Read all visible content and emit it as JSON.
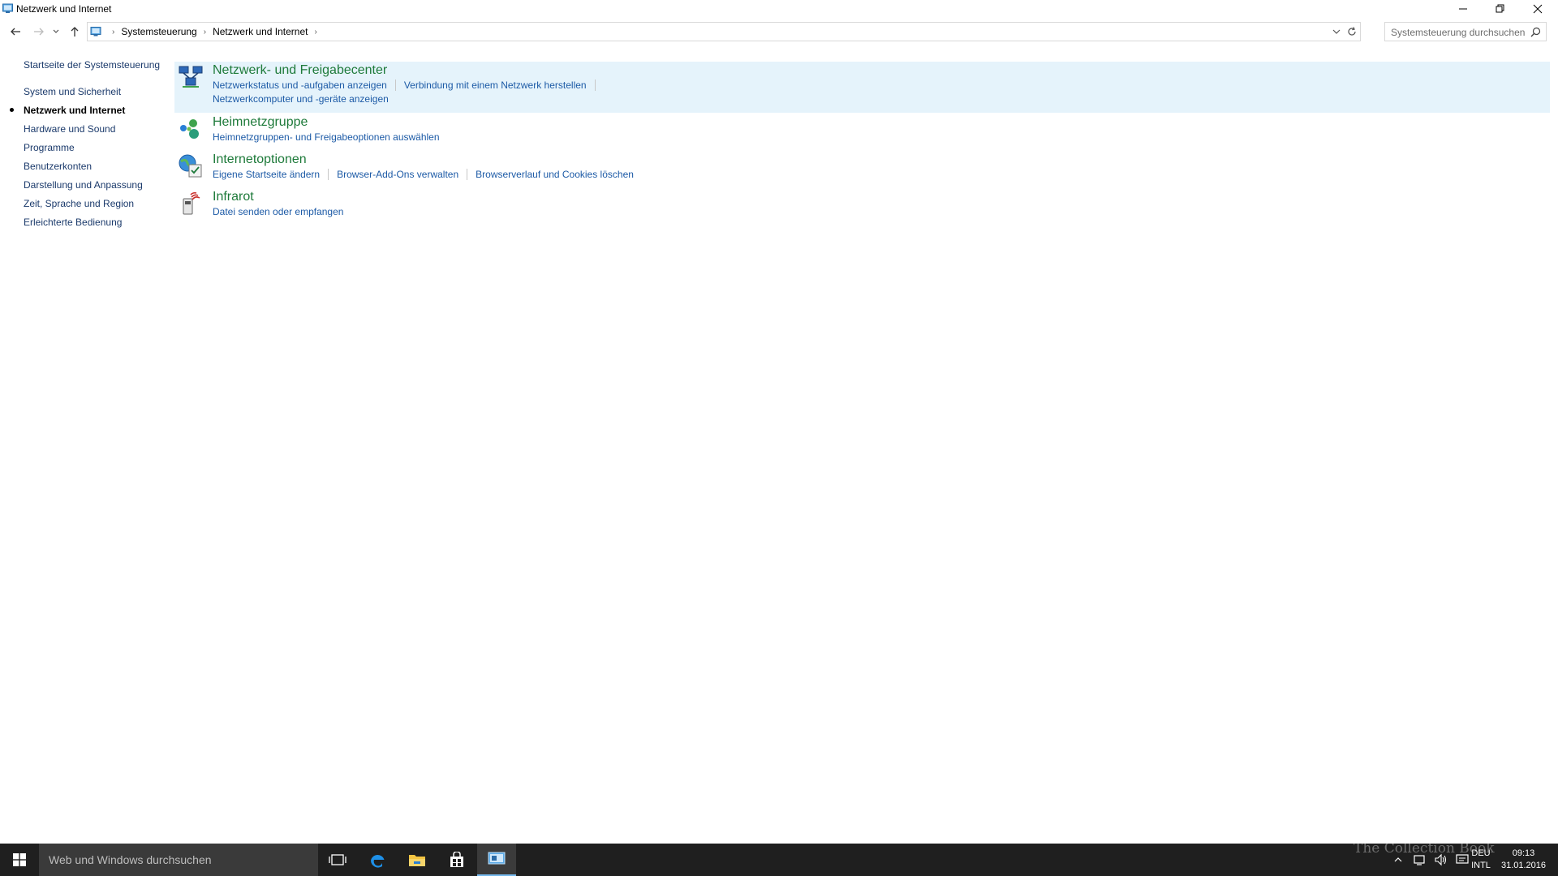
{
  "window": {
    "title": "Netzwerk und Internet"
  },
  "address": {
    "breadcrumbs": [
      "Systemsteuerung",
      "Netzwerk und Internet"
    ],
    "search_placeholder": "Systemsteuerung durchsuchen"
  },
  "leftnav": {
    "home": "Startseite der Systemsteuerung",
    "items": [
      {
        "label": "System und Sicherheit",
        "active": false
      },
      {
        "label": "Netzwerk und Internet",
        "active": true
      },
      {
        "label": "Hardware und Sound",
        "active": false
      },
      {
        "label": "Programme",
        "active": false
      },
      {
        "label": "Benutzerkonten",
        "active": false
      },
      {
        "label": "Darstellung und Anpassung",
        "active": false
      },
      {
        "label": "Zeit, Sprache und Region",
        "active": false
      },
      {
        "label": "Erleichterte Bedienung",
        "active": false
      }
    ]
  },
  "categories": [
    {
      "title": "Netzwerk- und Freigabecenter",
      "icon": "network-sharing-center-icon",
      "links": [
        "Netzwerkstatus und -aufgaben anzeigen",
        "Verbindung mit einem Netzwerk herstellen",
        "Netzwerkcomputer und -geräte anzeigen"
      ]
    },
    {
      "title": "Heimnetzgruppe",
      "icon": "homegroup-icon",
      "links": [
        "Heimnetzgruppen- und Freigabeoptionen auswählen"
      ]
    },
    {
      "title": "Internetoptionen",
      "icon": "internet-options-icon",
      "links": [
        "Eigene Startseite ändern",
        "Browser-Add-Ons verwalten",
        "Browserverlauf und Cookies löschen"
      ]
    },
    {
      "title": "Infrarot",
      "icon": "infrared-icon",
      "links": [
        "Datei senden oder empfangen"
      ]
    }
  ],
  "taskbar": {
    "search_text": "Web und Windows durchsuchen",
    "lang_top": "DEU",
    "lang_bottom": "INTL",
    "time": "09:13",
    "date": "31.01.2016",
    "watermark": "The Collection Book"
  },
  "colors": {
    "category_title": "#1e7a3a",
    "link": "#1c5aa6",
    "highlight": "#e5f3fb",
    "taskbar": "#1f1f1f"
  }
}
